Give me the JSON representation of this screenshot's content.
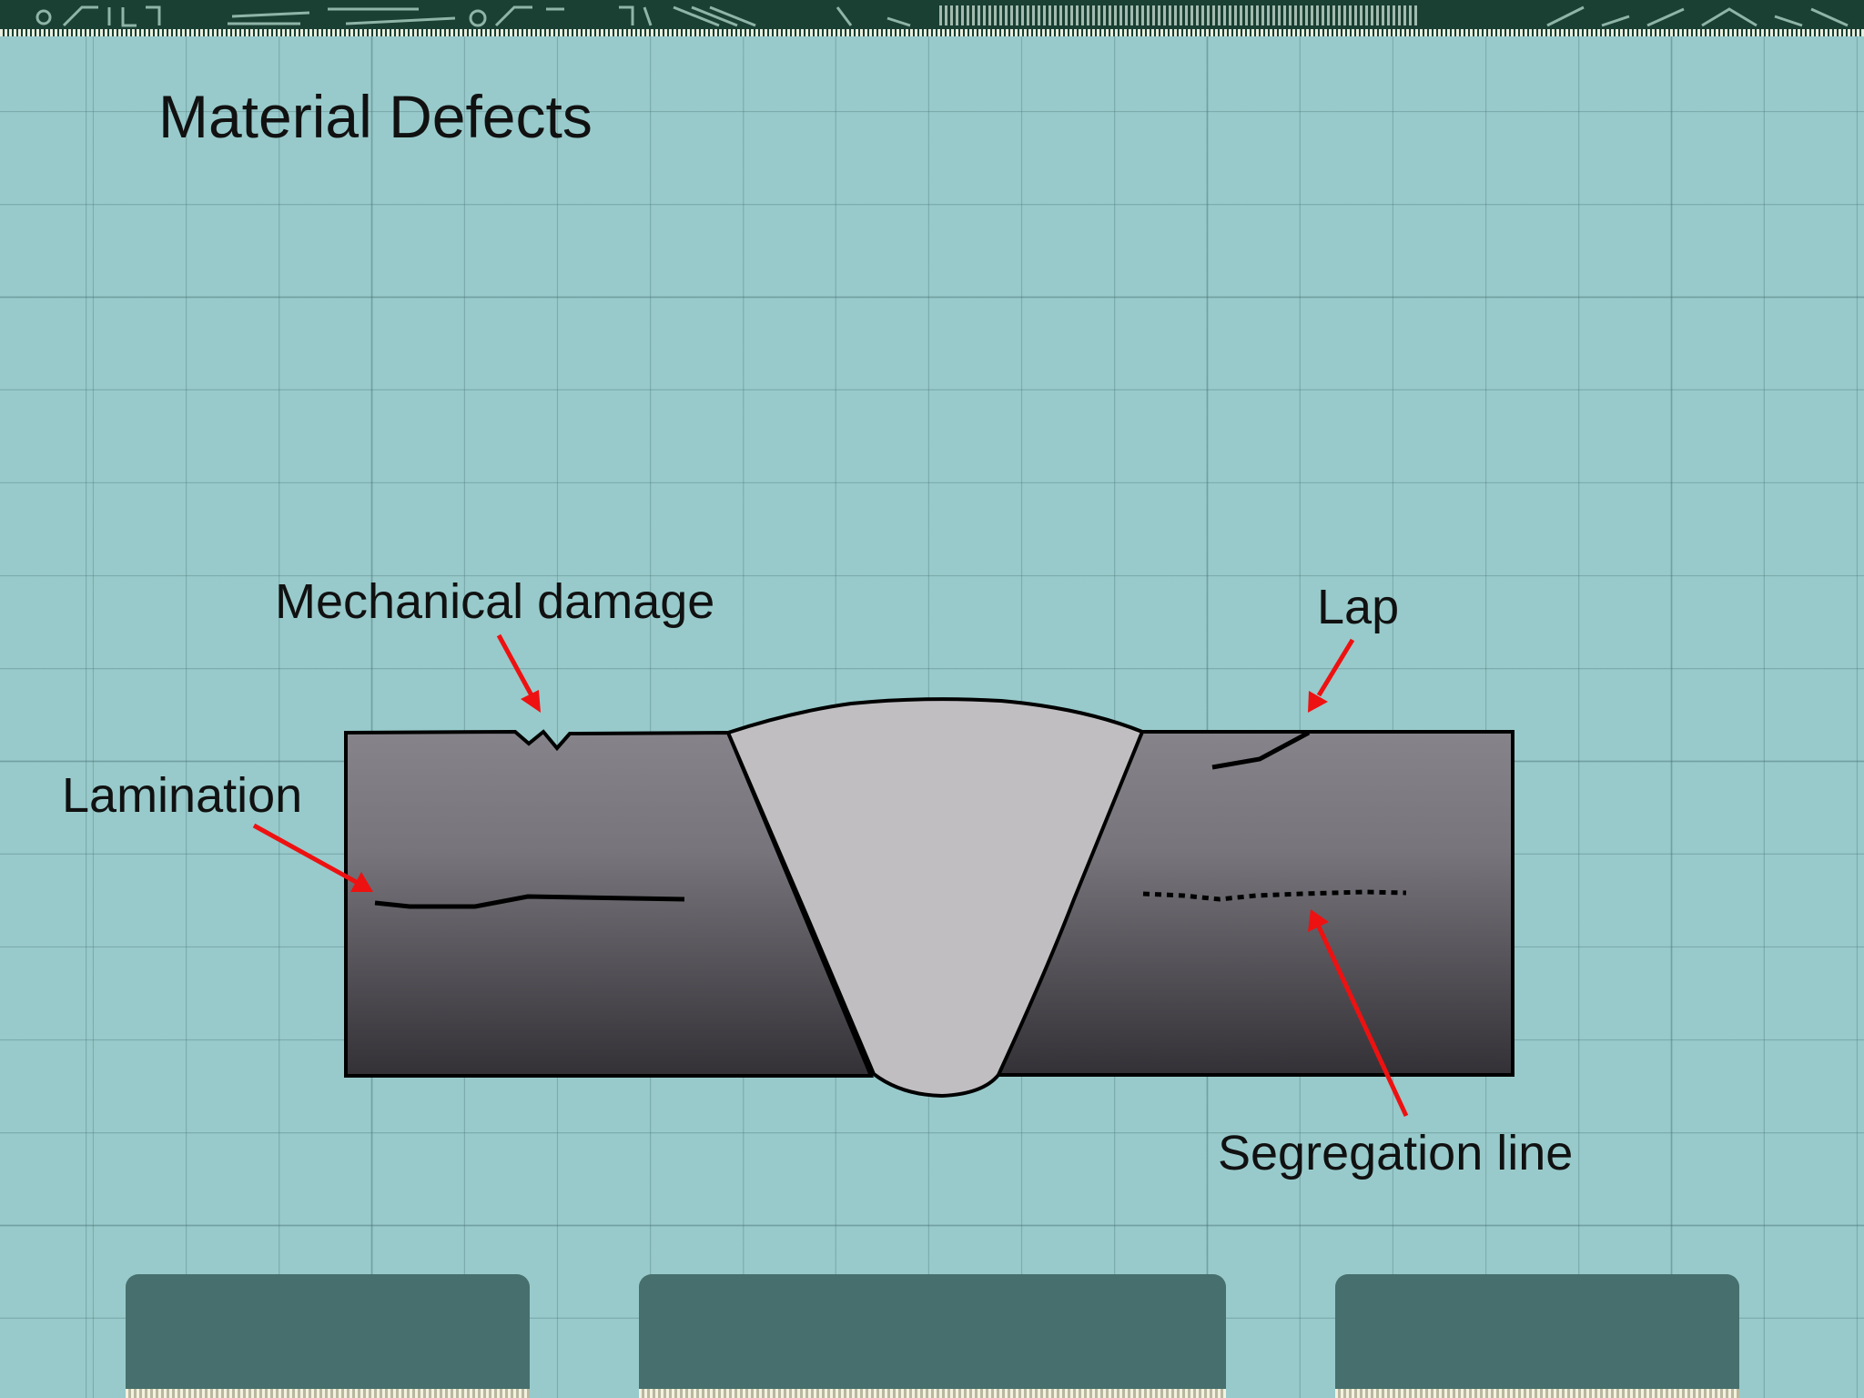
{
  "slide": {
    "title": "Material Defects"
  },
  "diagram": {
    "labels": {
      "mechanical_damage": "Mechanical damage",
      "lap": "Lap",
      "lamination": "Lamination",
      "segregation_line": "Segregation line"
    }
  },
  "colors": {
    "background": "#98cacb",
    "banner": "#1a3f33",
    "arrow": "#ee1111",
    "weld": "#c0bec1",
    "plate_top": "#86848a",
    "plate_bottom": "#333136",
    "footer_tab": "#466f6d"
  }
}
